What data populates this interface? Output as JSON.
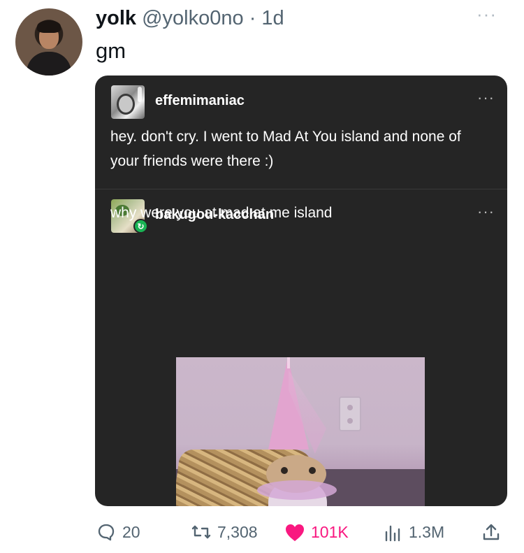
{
  "tweet": {
    "author": {
      "name": "yolk",
      "handle": "@yolko0no",
      "separator": "·",
      "time": "1d"
    },
    "text": "gm",
    "more_label": "···"
  },
  "embedded": {
    "post1": {
      "username": "effemimaniac",
      "text": "hey. don't cry. I went to Mad At You island and none of your friends were there :)",
      "more_label": "···"
    },
    "post2": {
      "username": "bakugou-kacchan",
      "text": "why were you at mad at me island",
      "more_label": "···",
      "badge_icon": "reblog-icon"
    }
  },
  "actions": {
    "reply_count": "20",
    "retweet_count": "7,308",
    "like_count": "101K",
    "views_count": "1.3M"
  },
  "colors": {
    "like": "#f91880",
    "secondary_text": "#536471",
    "card_bg": "#252525"
  },
  "icons": {
    "reply": "reply-icon",
    "retweet": "retweet-icon",
    "like": "heart-icon",
    "views": "views-icon",
    "share": "share-icon"
  }
}
